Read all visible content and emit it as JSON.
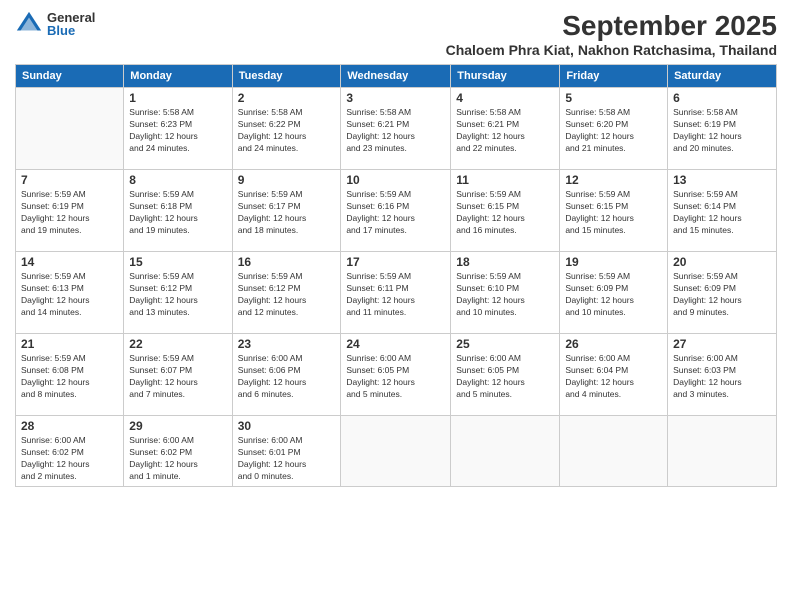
{
  "logo": {
    "general": "General",
    "blue": "Blue"
  },
  "title": {
    "month": "September 2025",
    "location": "Chaloem Phra Kiat, Nakhon Ratchasima, Thailand"
  },
  "calendar": {
    "headers": [
      "Sunday",
      "Monday",
      "Tuesday",
      "Wednesday",
      "Thursday",
      "Friday",
      "Saturday"
    ],
    "weeks": [
      [
        {
          "day": "",
          "info": ""
        },
        {
          "day": "1",
          "info": "Sunrise: 5:58 AM\nSunset: 6:23 PM\nDaylight: 12 hours\nand 24 minutes."
        },
        {
          "day": "2",
          "info": "Sunrise: 5:58 AM\nSunset: 6:22 PM\nDaylight: 12 hours\nand 24 minutes."
        },
        {
          "day": "3",
          "info": "Sunrise: 5:58 AM\nSunset: 6:21 PM\nDaylight: 12 hours\nand 23 minutes."
        },
        {
          "day": "4",
          "info": "Sunrise: 5:58 AM\nSunset: 6:21 PM\nDaylight: 12 hours\nand 22 minutes."
        },
        {
          "day": "5",
          "info": "Sunrise: 5:58 AM\nSunset: 6:20 PM\nDaylight: 12 hours\nand 21 minutes."
        },
        {
          "day": "6",
          "info": "Sunrise: 5:58 AM\nSunset: 6:19 PM\nDaylight: 12 hours\nand 20 minutes."
        }
      ],
      [
        {
          "day": "7",
          "info": "Sunrise: 5:59 AM\nSunset: 6:19 PM\nDaylight: 12 hours\nand 19 minutes."
        },
        {
          "day": "8",
          "info": "Sunrise: 5:59 AM\nSunset: 6:18 PM\nDaylight: 12 hours\nand 19 minutes."
        },
        {
          "day": "9",
          "info": "Sunrise: 5:59 AM\nSunset: 6:17 PM\nDaylight: 12 hours\nand 18 minutes."
        },
        {
          "day": "10",
          "info": "Sunrise: 5:59 AM\nSunset: 6:16 PM\nDaylight: 12 hours\nand 17 minutes."
        },
        {
          "day": "11",
          "info": "Sunrise: 5:59 AM\nSunset: 6:15 PM\nDaylight: 12 hours\nand 16 minutes."
        },
        {
          "day": "12",
          "info": "Sunrise: 5:59 AM\nSunset: 6:15 PM\nDaylight: 12 hours\nand 15 minutes."
        },
        {
          "day": "13",
          "info": "Sunrise: 5:59 AM\nSunset: 6:14 PM\nDaylight: 12 hours\nand 15 minutes."
        }
      ],
      [
        {
          "day": "14",
          "info": "Sunrise: 5:59 AM\nSunset: 6:13 PM\nDaylight: 12 hours\nand 14 minutes."
        },
        {
          "day": "15",
          "info": "Sunrise: 5:59 AM\nSunset: 6:12 PM\nDaylight: 12 hours\nand 13 minutes."
        },
        {
          "day": "16",
          "info": "Sunrise: 5:59 AM\nSunset: 6:12 PM\nDaylight: 12 hours\nand 12 minutes."
        },
        {
          "day": "17",
          "info": "Sunrise: 5:59 AM\nSunset: 6:11 PM\nDaylight: 12 hours\nand 11 minutes."
        },
        {
          "day": "18",
          "info": "Sunrise: 5:59 AM\nSunset: 6:10 PM\nDaylight: 12 hours\nand 10 minutes."
        },
        {
          "day": "19",
          "info": "Sunrise: 5:59 AM\nSunset: 6:09 PM\nDaylight: 12 hours\nand 10 minutes."
        },
        {
          "day": "20",
          "info": "Sunrise: 5:59 AM\nSunset: 6:09 PM\nDaylight: 12 hours\nand 9 minutes."
        }
      ],
      [
        {
          "day": "21",
          "info": "Sunrise: 5:59 AM\nSunset: 6:08 PM\nDaylight: 12 hours\nand 8 minutes."
        },
        {
          "day": "22",
          "info": "Sunrise: 5:59 AM\nSunset: 6:07 PM\nDaylight: 12 hours\nand 7 minutes."
        },
        {
          "day": "23",
          "info": "Sunrise: 6:00 AM\nSunset: 6:06 PM\nDaylight: 12 hours\nand 6 minutes."
        },
        {
          "day": "24",
          "info": "Sunrise: 6:00 AM\nSunset: 6:05 PM\nDaylight: 12 hours\nand 5 minutes."
        },
        {
          "day": "25",
          "info": "Sunrise: 6:00 AM\nSunset: 6:05 PM\nDaylight: 12 hours\nand 5 minutes."
        },
        {
          "day": "26",
          "info": "Sunrise: 6:00 AM\nSunset: 6:04 PM\nDaylight: 12 hours\nand 4 minutes."
        },
        {
          "day": "27",
          "info": "Sunrise: 6:00 AM\nSunset: 6:03 PM\nDaylight: 12 hours\nand 3 minutes."
        }
      ],
      [
        {
          "day": "28",
          "info": "Sunrise: 6:00 AM\nSunset: 6:02 PM\nDaylight: 12 hours\nand 2 minutes."
        },
        {
          "day": "29",
          "info": "Sunrise: 6:00 AM\nSunset: 6:02 PM\nDaylight: 12 hours\nand 1 minute."
        },
        {
          "day": "30",
          "info": "Sunrise: 6:00 AM\nSunset: 6:01 PM\nDaylight: 12 hours\nand 0 minutes."
        },
        {
          "day": "",
          "info": ""
        },
        {
          "day": "",
          "info": ""
        },
        {
          "day": "",
          "info": ""
        },
        {
          "day": "",
          "info": ""
        }
      ]
    ]
  }
}
